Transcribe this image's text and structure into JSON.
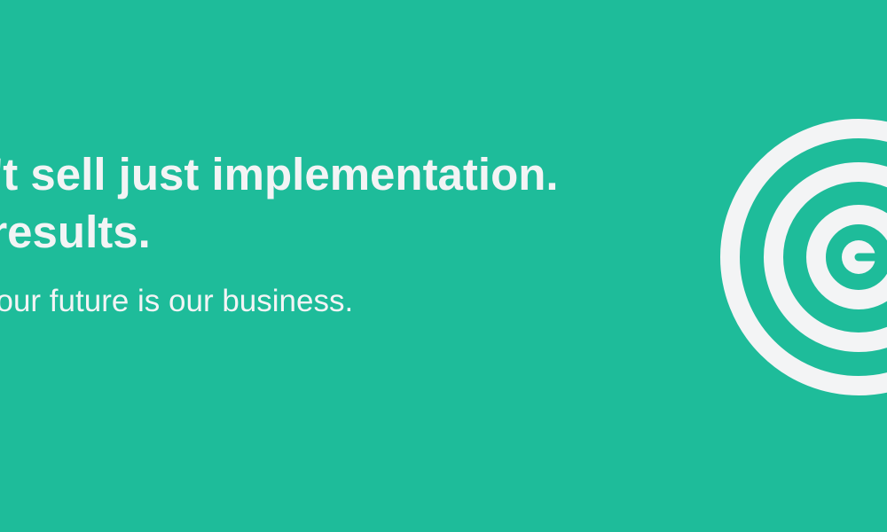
{
  "colors": {
    "background": "#1EBC9A",
    "foreground": "#F3F4F5"
  },
  "banner": {
    "headline_line_1": "n't sell just implementation.",
    "headline_line_2": "l results.",
    "subline": "your future is our business.",
    "graphic_icon": "target-icon"
  }
}
